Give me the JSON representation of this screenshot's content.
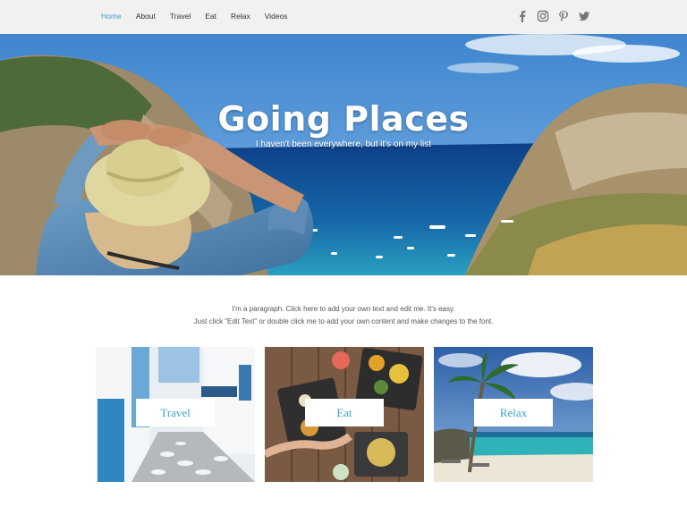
{
  "nav": {
    "items": [
      {
        "label": "Home",
        "active": true
      },
      {
        "label": "About",
        "active": false
      },
      {
        "label": "Travel",
        "active": false
      },
      {
        "label": "Eat",
        "active": false
      },
      {
        "label": "Relax",
        "active": false
      },
      {
        "label": "Videos",
        "active": false
      }
    ],
    "active_color": "#3aa3c6"
  },
  "social": [
    "facebook-icon",
    "instagram-icon",
    "pinterest-icon",
    "twitter-icon"
  ],
  "hero": {
    "title": "Going Places",
    "subtitle": "I haven't been everywhere, but it's on my list"
  },
  "intro": {
    "line1": "I'm a paragraph. Click here to add your own text and edit me. It's easy.",
    "line2": "Just click “Edit Text” or double click me to add your own content and make changes to the font."
  },
  "cards": [
    {
      "label": "Travel"
    },
    {
      "label": "Eat"
    },
    {
      "label": "Relax"
    }
  ]
}
